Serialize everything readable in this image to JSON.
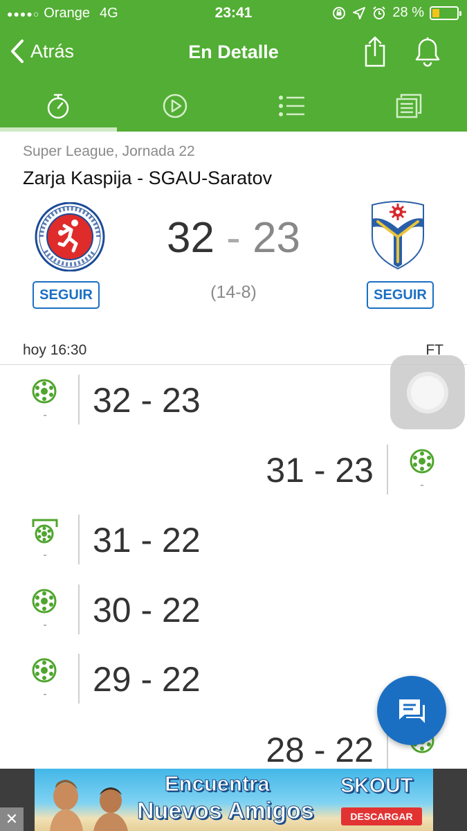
{
  "status_bar": {
    "carrier": "Orange",
    "network": "4G",
    "time": "23:41",
    "battery": "28 %",
    "battery_level": 0.28
  },
  "nav": {
    "back_label": "Atrás",
    "title": "En Detalle"
  },
  "tabs": [
    {
      "icon": "stopwatch-icon",
      "active": true
    },
    {
      "icon": "play-icon",
      "active": false
    },
    {
      "icon": "list-icon",
      "active": false
    },
    {
      "icon": "report-icon",
      "active": false
    }
  ],
  "match": {
    "league": "Super League, Jornada 22",
    "title": "Zarja Kaspija - SGAU-Saratov",
    "home_score": "32",
    "away_score": "23",
    "separator": "-",
    "halftime": "(14-8)",
    "follow_label": "SEGUIR",
    "date": "hoy 16:30",
    "status": "FT"
  },
  "events": [
    {
      "side": "left",
      "icon": "ball-icon",
      "score": "32 - 23",
      "minute": "-"
    },
    {
      "side": "right",
      "icon": "ball-icon",
      "score": "31 - 23",
      "minute": "-"
    },
    {
      "side": "left",
      "icon": "goal-net-icon",
      "score": "31 - 22",
      "minute": "-"
    },
    {
      "side": "left",
      "icon": "ball-icon",
      "score": "30 - 22",
      "minute": "-"
    },
    {
      "side": "left",
      "icon": "ball-icon",
      "score": "29 - 22",
      "minute": "-"
    },
    {
      "side": "right",
      "icon": "ball-icon",
      "score": "28 - 22",
      "minute": "-"
    }
  ],
  "ad": {
    "line1": "Encuentra",
    "line2": "Nuevos Amigos",
    "brand": "SKOUT",
    "cta": "DESCARGAR"
  },
  "colors": {
    "header_green": "#52ae34",
    "accent_blue": "#1a6fc3",
    "event_icon_green": "#4fa52e"
  }
}
